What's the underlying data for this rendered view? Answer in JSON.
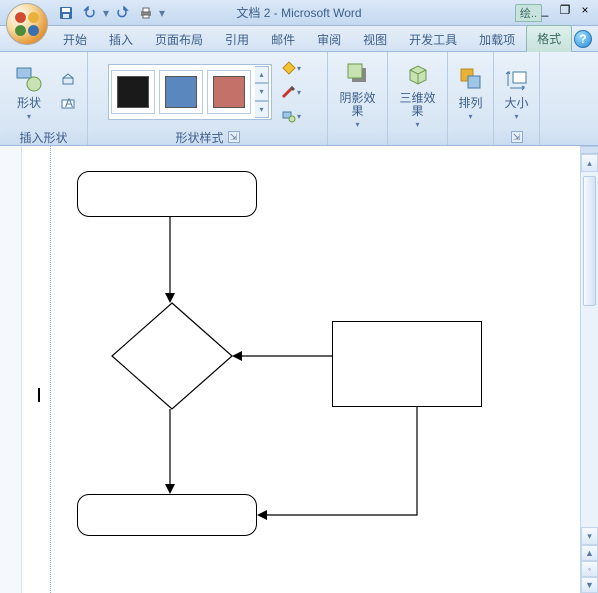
{
  "window": {
    "doc_title": "文档 2",
    "app_name": "Microsoft Word",
    "context_label": "绘..",
    "minimize": "_",
    "restore": "❐",
    "close": "×"
  },
  "qat": {
    "save": "save-icon",
    "undo": "undo-icon",
    "redo": "redo-icon",
    "print": "print-icon"
  },
  "tabs": {
    "home": "开始",
    "insert": "插入",
    "layout": "页面布局",
    "references": "引用",
    "mailings": "邮件",
    "review": "审阅",
    "view": "视图",
    "developer": "开发工具",
    "addins": "加载项",
    "format": "格式",
    "help": "?"
  },
  "ribbon": {
    "insert_shapes": {
      "shapes_btn": "形状",
      "label": "插入形状"
    },
    "shape_styles": {
      "label": "形状样式",
      "swatches": [
        {
          "fill": "#1a1a1a"
        },
        {
          "fill": "#5a87bd"
        },
        {
          "fill": "#c4716a"
        }
      ],
      "fill": "形状填充",
      "outline": "形状轮廓",
      "change": "更改形状"
    },
    "shadow": {
      "label": "阴影效果"
    },
    "threed": {
      "label": "三维效果"
    },
    "arrange": {
      "label": "排列"
    },
    "size": {
      "label": "大小"
    }
  },
  "icons": {
    "chevron_down": "▾",
    "chevron_up": "▴",
    "more": "▾",
    "dlaunch": "⇲"
  }
}
